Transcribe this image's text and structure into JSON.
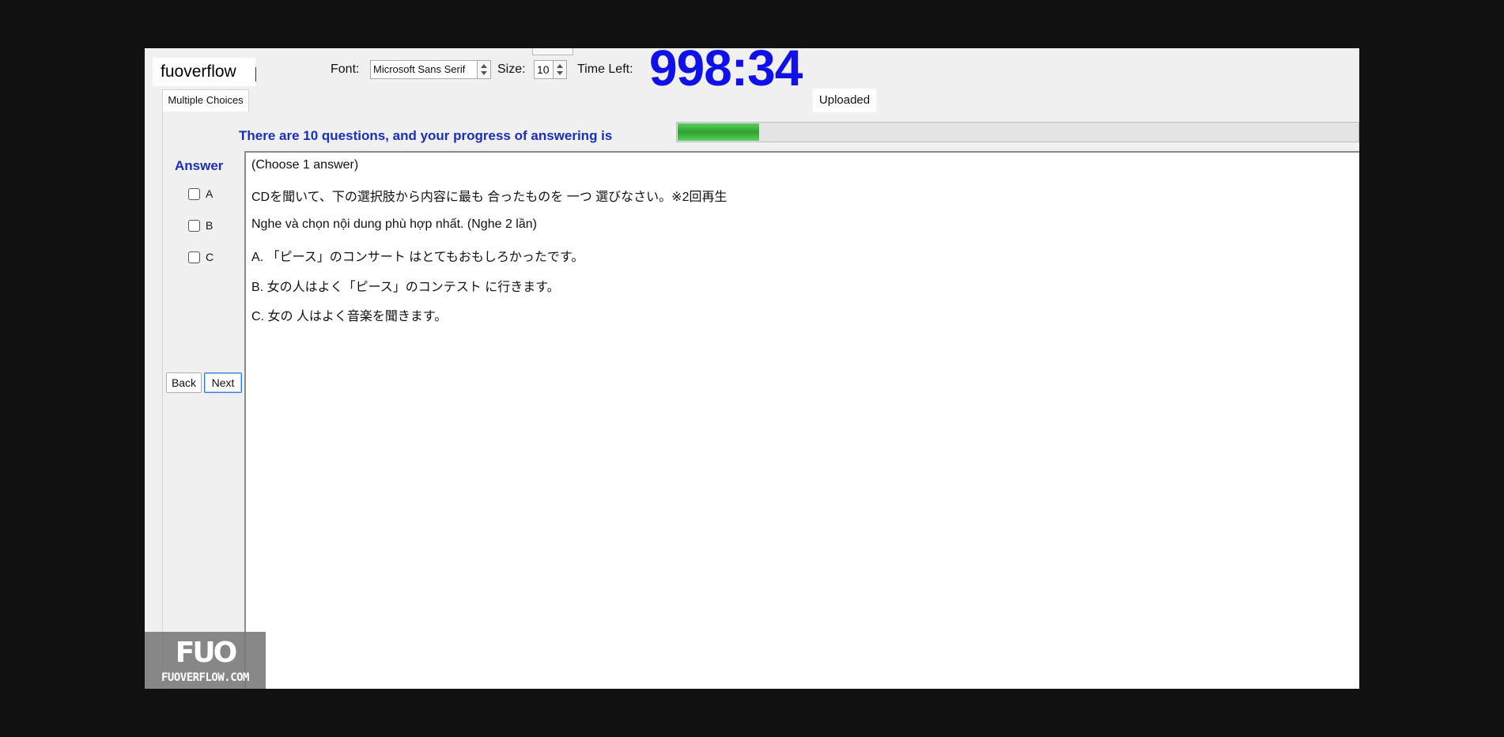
{
  "header": {
    "username": "fuoverflow",
    "font_label": "Font:",
    "font_value": "Microsoft Sans Serif",
    "size_label": "Size:",
    "size_value": "10",
    "time_label": "Time Left:",
    "time_value": "998:34"
  },
  "tabs": {
    "active": "Multiple Choices",
    "status": "Uploaded"
  },
  "progress": {
    "text": "There are 10 questions, and your progress of answering is",
    "fraction": 0.12
  },
  "answer": {
    "title": "Answer",
    "options": [
      "A",
      "B",
      "C"
    ]
  },
  "nav": {
    "back": "Back",
    "next": "Next"
  },
  "question": {
    "lines": [
      "(Choose 1 answer)",
      "CDを聞いて、下の選択肢から内容に最も 合ったものを 一つ 選びなさい。※2回再生",
      "Nghe và chọn nội dung phù hợp nhất.  (Nghe 2 lần)",
      "A. 「ピース」のコンサート はとてもおもしろかったです。",
      "B.  女の人はよく「ピース」のコンテスト に行きます。",
      "C.  女の 人はよく音楽を聞きます。"
    ]
  },
  "watermark": {
    "logo": "FUO",
    "text": "FUOVERFLOW.COM"
  },
  "colors": {
    "accent_blue": "#1a2fb8",
    "timer_blue": "#1010e8",
    "progress_green": "#2ea12f"
  }
}
